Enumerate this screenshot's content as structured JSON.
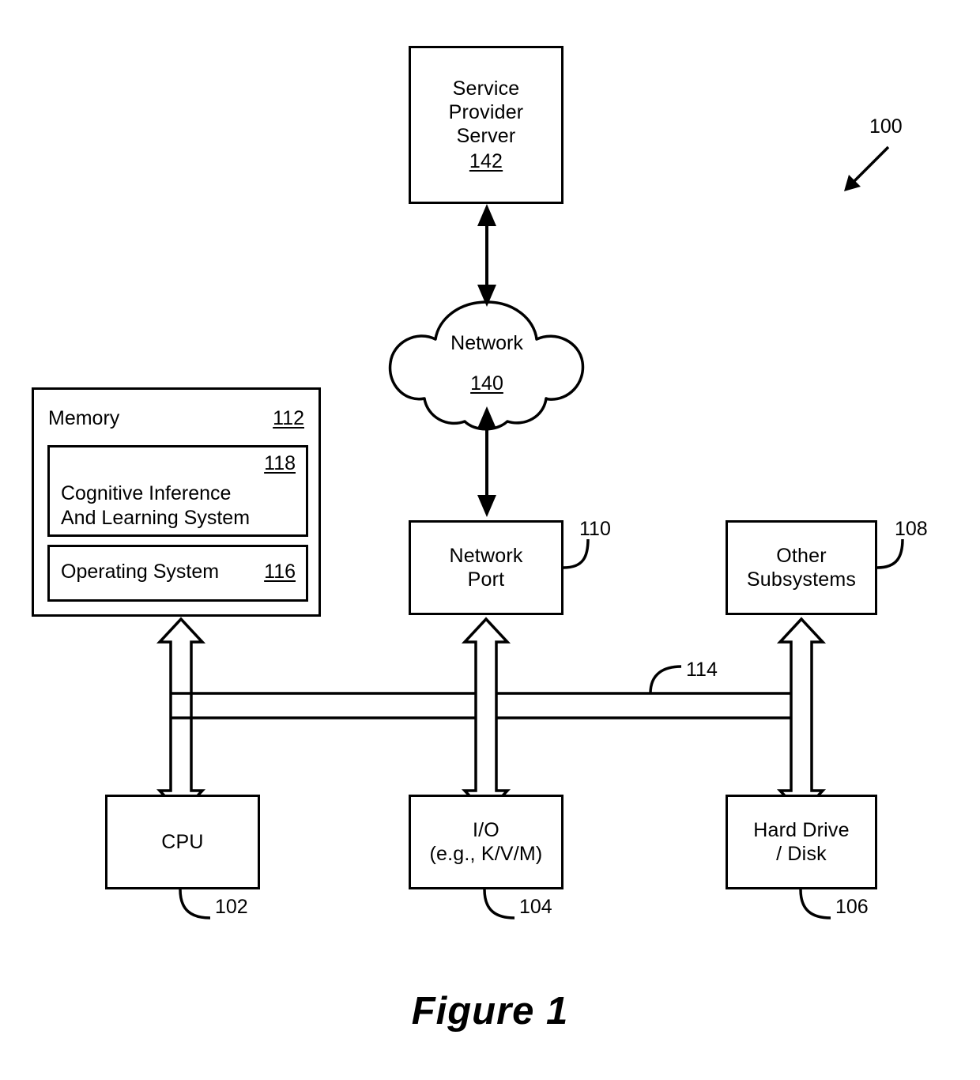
{
  "figure": {
    "caption": "Figure 1",
    "system_ref": "100"
  },
  "nodes": {
    "server": {
      "label": "Service\nProvider\nServer",
      "ref": "142"
    },
    "network": {
      "label": "Network",
      "ref": "140"
    },
    "memory": {
      "title": "Memory",
      "ref": "112",
      "modules": [
        {
          "label": "Cognitive Inference\nAnd Learning System",
          "ref": "118"
        },
        {
          "label": "Operating System",
          "ref": "116"
        }
      ]
    },
    "network_port": {
      "label": "Network\nPort",
      "ref": "110"
    },
    "other_subsystems": {
      "label": "Other\nSubsystems",
      "ref": "108"
    },
    "cpu": {
      "label": "CPU",
      "ref": "102"
    },
    "io": {
      "label": "I/O\n(e.g., K/V/M)",
      "ref": "104"
    },
    "hard_drive": {
      "label": "Hard Drive\n/ Disk",
      "ref": "106"
    },
    "bus": {
      "ref": "114"
    }
  },
  "colors": {
    "stroke": "#000000",
    "background": "#ffffff"
  }
}
